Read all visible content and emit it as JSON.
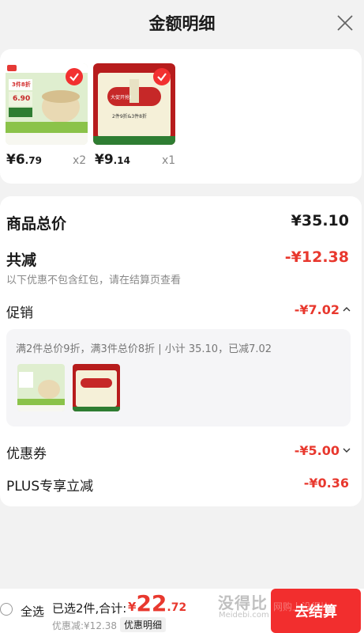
{
  "header": {
    "title": "金额明细"
  },
  "products": [
    {
      "price_int": "¥6",
      "price_dec": ".79",
      "qty": "x2",
      "thumb_text": "3件8折",
      "thumb_price": "6.90"
    },
    {
      "price_int": "¥9",
      "price_dec": ".14",
      "qty": "x1",
      "thumb_text": "大促开抢!",
      "thumb_sub": "2件9折&3件8折"
    }
  ],
  "summary": {
    "total_label": "商品总价",
    "total_value": "¥35.10",
    "reduce_label": "共减",
    "reduce_value": "-¥12.38",
    "reduce_note": "以下优惠不包含红包，请在结算页查看",
    "promo_label": "促销",
    "promo_value": "-¥7.02",
    "promo_desc": "满2件总价9折，满3件总价8折 | 小计 35.10，已减7.02",
    "coupon_label": "优惠券",
    "coupon_value": "-¥5.00",
    "plus_label": "PLUS专享立减",
    "plus_value": "-¥0.36"
  },
  "bottom": {
    "select_all": "全选",
    "selected_info": "已选2件,合计:",
    "total_currency": "¥",
    "total_int": "22",
    "total_dec": ".72",
    "discount_text": "优惠减:¥12.38",
    "detail_tag": "优惠明细",
    "checkout_label": "去结算",
    "watermark": "没得比",
    "watermark_sub": "Meidebi.com",
    "watermark_2": "网购上没得比"
  },
  "colors": {
    "accent": "#e8382e",
    "checkout": "#f22e2e",
    "green": "#4caf50"
  }
}
